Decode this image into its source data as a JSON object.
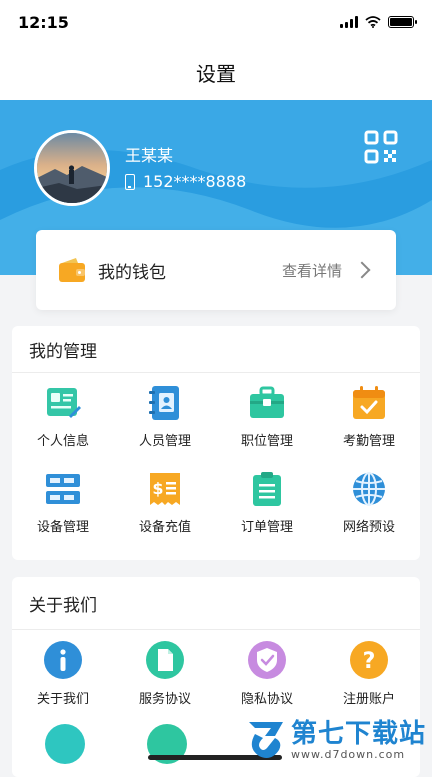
{
  "status_bar": {
    "time": "12:15"
  },
  "nav": {
    "title": "设置"
  },
  "profile": {
    "name": "王某某",
    "phone": "152****8888"
  },
  "wallet": {
    "label": "我的钱包",
    "detail": "查看详情"
  },
  "management": {
    "title": "我的管理",
    "items": [
      {
        "label": "个人信息",
        "icon": "id-card-icon"
      },
      {
        "label": "人员管理",
        "icon": "contacts-book-icon"
      },
      {
        "label": "职位管理",
        "icon": "briefcase-icon"
      },
      {
        "label": "考勤管理",
        "icon": "calendar-check-icon"
      },
      {
        "label": "设备管理",
        "icon": "device-rack-icon"
      },
      {
        "label": "设备充值",
        "icon": "recharge-receipt-icon"
      },
      {
        "label": "订单管理",
        "icon": "clipboard-list-icon"
      },
      {
        "label": "网络预设",
        "icon": "globe-icon"
      }
    ]
  },
  "about": {
    "title": "关于我们",
    "items": [
      {
        "label": "关于我们",
        "icon": "info-icon"
      },
      {
        "label": "服务协议",
        "icon": "document-icon"
      },
      {
        "label": "隐私协议",
        "icon": "shield-check-icon"
      },
      {
        "label": "注册账户",
        "icon": "question-icon"
      }
    ]
  },
  "colors": {
    "hero_blue": "#2a9de0",
    "orange": "#f7a823",
    "green": "#2ec6a0",
    "blue_icon": "#2f8fd8",
    "purple": "#c78be0"
  },
  "watermark": {
    "brand": "第七下载站",
    "url": "www.d7down.com"
  }
}
